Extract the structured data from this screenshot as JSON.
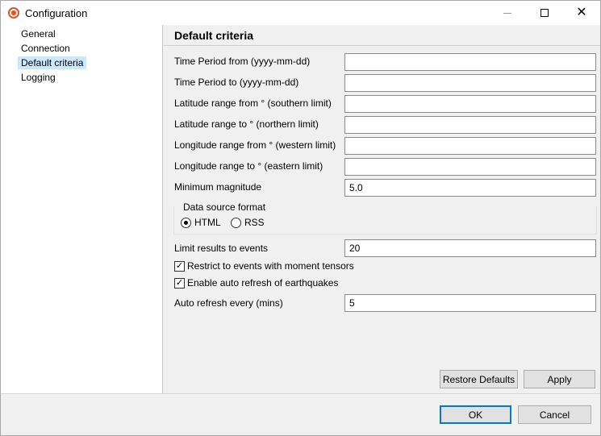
{
  "window": {
    "title": "Configuration",
    "minimize_label": "",
    "maximize_label": "",
    "close_label": "✕"
  },
  "sidebar": {
    "items": [
      {
        "label": "General",
        "selected": false
      },
      {
        "label": "Connection",
        "selected": false
      },
      {
        "label": "Default criteria",
        "selected": true
      },
      {
        "label": "Logging",
        "selected": false
      }
    ]
  },
  "panel": {
    "title": "Default criteria",
    "fields": [
      {
        "label": "Time Period from (yyyy-mm-dd)",
        "value": ""
      },
      {
        "label": "Time Period to (yyyy-mm-dd)",
        "value": ""
      },
      {
        "label": "Latitude range from ° (southern limit)",
        "value": ""
      },
      {
        "label": "Latitude range to ° (northern limit)",
        "value": ""
      },
      {
        "label": "Longitude range from ° (western limit)",
        "value": ""
      },
      {
        "label": "Longitude range to ° (eastern limit)",
        "value": ""
      },
      {
        "label": "Minimum magnitude",
        "value": "5.0"
      }
    ],
    "data_source": {
      "legend": "Data source format",
      "options": [
        {
          "label": "HTML",
          "checked": true
        },
        {
          "label": "RSS",
          "checked": false
        }
      ]
    },
    "limit_results": {
      "label": "Limit results to events",
      "value": "20"
    },
    "restrict_moment": {
      "label": "Restrict to events with moment tensors",
      "checked": true
    },
    "auto_refresh_enable": {
      "label": "Enable auto refresh of earthquakes",
      "checked": true
    },
    "auto_refresh_every": {
      "label": "Auto refresh every (mins)",
      "value": "5"
    },
    "restore_defaults_label": "Restore Defaults",
    "apply_label": "Apply"
  },
  "footer": {
    "ok_label": "OK",
    "cancel_label": "Cancel"
  },
  "colors": {
    "selection": "#cce8ff",
    "accent": "#0078d7",
    "app_icon": "#e8531f"
  }
}
